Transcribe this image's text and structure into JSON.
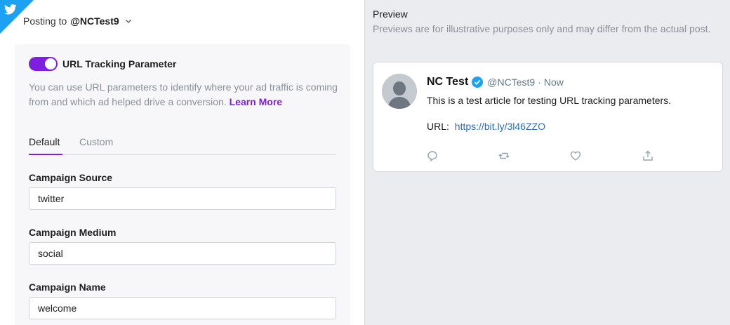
{
  "header": {
    "posting_prefix": "Posting to",
    "account_handle": "@NCTest9",
    "brand_icon": "twitter-bird-icon"
  },
  "tracking": {
    "toggle_label": "URL Tracking Parameter",
    "toggle_on": true,
    "help_text": "You can use URL parameters to identify where your ad traffic is coming from and which ad helped drive a conversion.",
    "learn_more": "Learn More"
  },
  "tabs": [
    {
      "label": "Default",
      "active": true
    },
    {
      "label": "Custom",
      "active": false
    }
  ],
  "fields": {
    "campaign_source": {
      "label": "Campaign Source",
      "value": "twitter"
    },
    "campaign_medium": {
      "label": "Campaign Medium",
      "value": "social"
    },
    "campaign_name": {
      "label": "Campaign Name",
      "value": "welcome"
    }
  },
  "preview": {
    "title": "Preview",
    "note": "Previews are for illustrative purposes only and may differ from the actual post.",
    "tweet": {
      "name": "NC Test",
      "handle": "@NCTest9",
      "separator": "·",
      "time": "Now",
      "text": "This is a test article for testing URL tracking parameters.",
      "url_prefix": "URL:",
      "url": "https://bit.ly/3l46ZZO"
    }
  },
  "colors": {
    "accent": "#7e1fe0",
    "twitter_blue": "#1da1f2",
    "link": "#2b6db8"
  }
}
